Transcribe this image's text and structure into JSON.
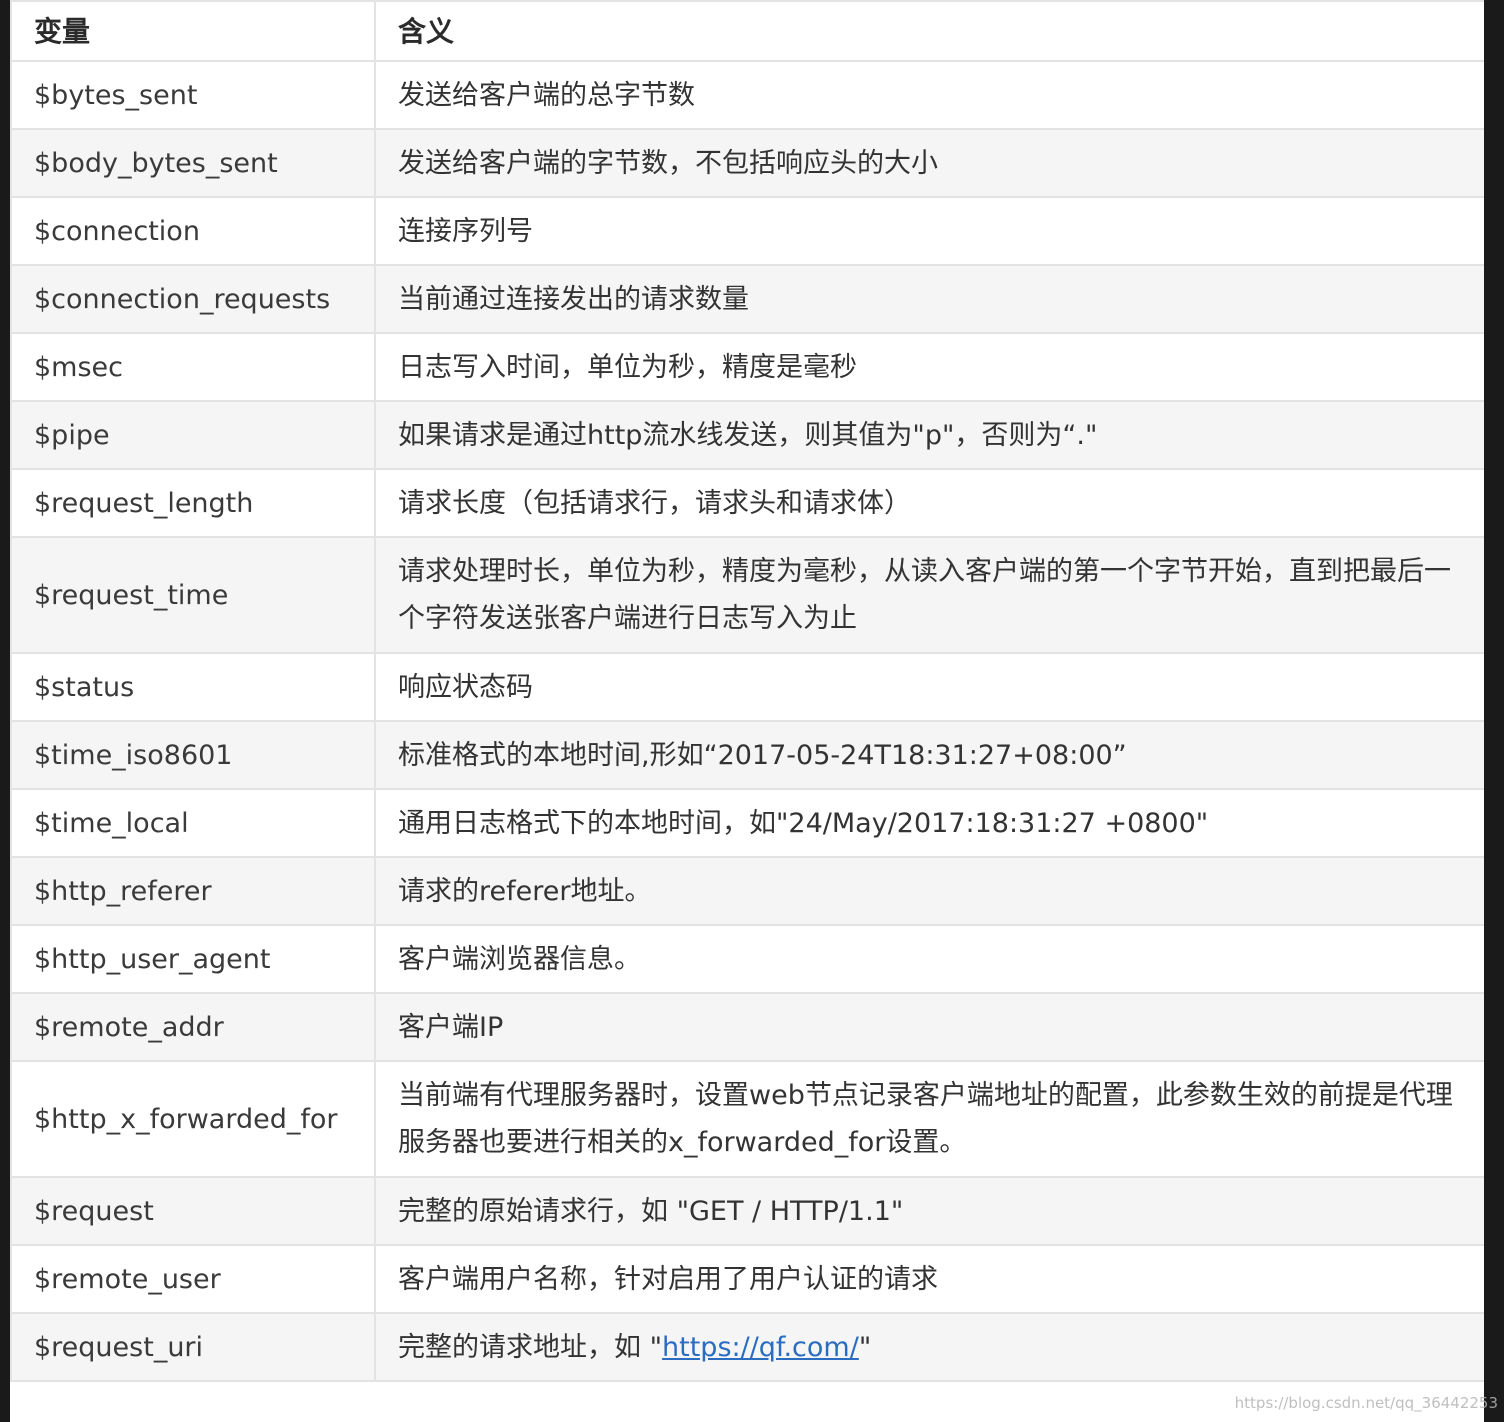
{
  "table": {
    "headers": [
      "变量",
      "含义"
    ],
    "rows": [
      {
        "var": "$bytes_sent",
        "desc": "发送给客户端的总字节数"
      },
      {
        "var": "$body_bytes_sent",
        "desc": "发送给客户端的字节数，不包括响应头的大小"
      },
      {
        "var": "$connection",
        "desc": "连接序列号"
      },
      {
        "var": "$connection_requests",
        "desc": "当前通过连接发出的请求数量"
      },
      {
        "var": "$msec",
        "desc": "日志写入时间，单位为秒，精度是毫秒"
      },
      {
        "var": "$pipe",
        "desc": "如果请求是通过http流水线发送，则其值为\"p\"，否则为“.\""
      },
      {
        "var": "$request_length",
        "desc": "请求长度（包括请求行，请求头和请求体）"
      },
      {
        "var": "$request_time",
        "desc": "请求处理时长，单位为秒，精度为毫秒，从读入客户端的第一个字节开始，直到把最后一个字符发送张客户端进行日志写入为止"
      },
      {
        "var": "$status",
        "desc": "响应状态码"
      },
      {
        "var": "$time_iso8601",
        "desc": "标准格式的本地时间,形如“2017-05-24T18:31:27+08:00”"
      },
      {
        "var": "$time_local",
        "desc": "通用日志格式下的本地时间，如\"24/May/2017:18:31:27 +0800\""
      },
      {
        "var": "$http_referer",
        "desc": "请求的referer地址。"
      },
      {
        "var": "$http_user_agent",
        "desc": "客户端浏览器信息。"
      },
      {
        "var": "$remote_addr",
        "desc": "客户端IP"
      },
      {
        "var": "$http_x_forwarded_for",
        "desc": "当前端有代理服务器时，设置web节点记录客户端地址的配置，此参数生效的前提是代理服务器也要进行相关的x_forwarded_for设置。"
      },
      {
        "var": "$request",
        "desc": "完整的原始请求行，如 \"GET / HTTP/1.1\""
      },
      {
        "var": "$remote_user",
        "desc": "客户端用户名称，针对启用了用户认证的请求"
      },
      {
        "var": "$request_uri",
        "desc_prefix": "完整的请求地址，如 \"",
        "link": "https://qf.com/",
        "desc_suffix": "\""
      }
    ]
  },
  "watermark": "https://blog.csdn.net/qq_36442253"
}
